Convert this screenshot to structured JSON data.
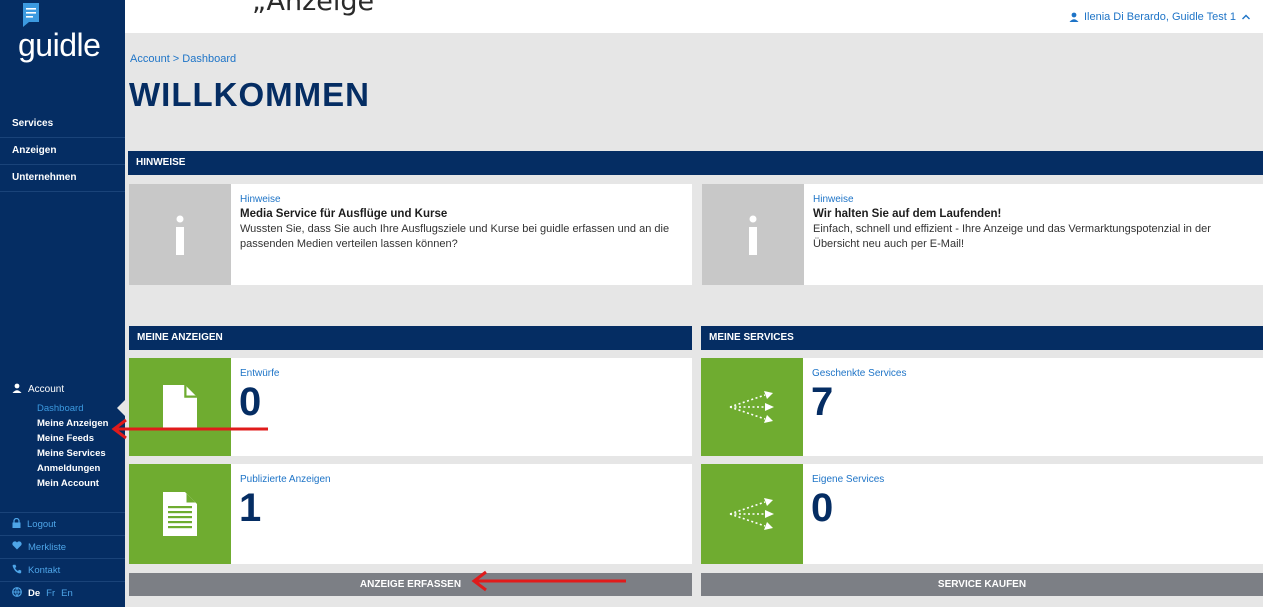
{
  "top": {
    "partial_text": "„Anzeige",
    "user_name": "Ilenia Di Berardo, Guidle Test 1"
  },
  "logo": {
    "text": "guidle"
  },
  "nav": {
    "items": [
      "Services",
      "Anzeigen",
      "Unternehmen"
    ]
  },
  "account": {
    "label": "Account",
    "sub_items": [
      "Dashboard",
      "Meine Anzeigen",
      "Meine Feeds",
      "Meine Services",
      "Anmeldungen",
      "Mein Account"
    ]
  },
  "bottom_links": {
    "logout": "Logout",
    "merkliste": "Merkliste",
    "kontakt": "Kontakt",
    "lang_de": "De",
    "lang_fr": "Fr",
    "lang_en": "En"
  },
  "breadcrumb": {
    "account": "Account",
    "separator": " > ",
    "current": "Dashboard"
  },
  "page_title": "WILLKOMMEN",
  "hinweise": {
    "header": "HINWEISE",
    "cards": [
      {
        "label": "Hinweise",
        "title": "Media Service für Ausflüge und Kurse",
        "body": "Wussten Sie, dass Sie auch Ihre Ausflugsziele und Kurse bei guidle erfassen und an die passenden Medien verteilen lassen können?"
      },
      {
        "label": "Hinweise",
        "title": "Wir halten Sie auf dem Laufenden!",
        "body": "Einfach, schnell und effizient - Ihre Anzeige und das Vermarktungspotenzial in der Übersicht neu auch per E-Mail!"
      }
    ]
  },
  "meine_anzeigen": {
    "header": "MEINE ANZEIGEN",
    "entwuerfe_label": "Entwürfe",
    "entwuerfe_count": "0",
    "publiziert_label": "Publizierte Anzeigen",
    "publiziert_count": "1",
    "button": "ANZEIGE ERFASSEN"
  },
  "meine_services": {
    "header": "MEINE SERVICES",
    "geschenkt_label": "Geschenkte Services",
    "geschenkt_count": "7",
    "eigene_label": "Eigene Services",
    "eigene_count": "0",
    "button": "SERVICE KAUFEN"
  },
  "colors": {
    "navy": "#052d63",
    "link_blue": "#1e74c7",
    "green": "#6fac30",
    "button_gray": "#7c7f85",
    "annotation_red": "#e01b1b"
  },
  "icons": {
    "logo": "speech-bubble-icon",
    "user": "user-icon",
    "chevron": "chevron-up-icon",
    "info": "info-icon",
    "document": "document-icon",
    "document_lines": "document-lines-icon",
    "share": "share-arrows-icon",
    "lock": "lock-icon",
    "heart": "heart-icon",
    "phone": "phone-icon",
    "globe": "globe-icon",
    "annotation": "red-arrow-icon"
  }
}
